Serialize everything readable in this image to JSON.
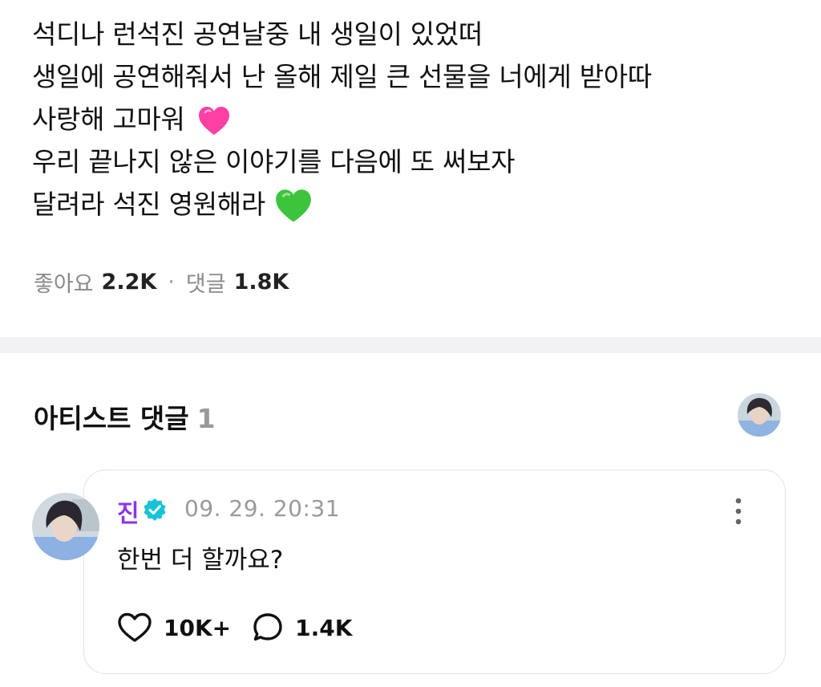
{
  "post": {
    "lines": [
      "석디나 런석진 공연날중 내 생일이 있었떠",
      "생일에 공연해줘서 난 올해 제일 큰 선물을 너에게 받아따",
      "사랑해 고마워",
      "우리 끝나지 않은 이야기를 다음에 또 써보자",
      "달려라 석진 영원해라"
    ],
    "emoji": {
      "pink_heart": "pink-heart-icon",
      "green_heart": "green-heart-icon"
    },
    "colors": {
      "pink_heart": "#ff3fa4",
      "green_heart": "#3cc43c"
    }
  },
  "stats": {
    "likes_label": "좋아요",
    "likes_value": "2.2K",
    "separator": "·",
    "comments_label": "댓글",
    "comments_value": "1.8K"
  },
  "artist_comments": {
    "title": "아티스트 댓글",
    "count": "1"
  },
  "comment": {
    "author": "진",
    "timestamp": "09. 29. 20:31",
    "text": "한번 더 할까요?",
    "likes": "10K+",
    "replies": "1.4K",
    "colors": {
      "author": "#8a35e6",
      "verified": "#17c3d9"
    }
  }
}
